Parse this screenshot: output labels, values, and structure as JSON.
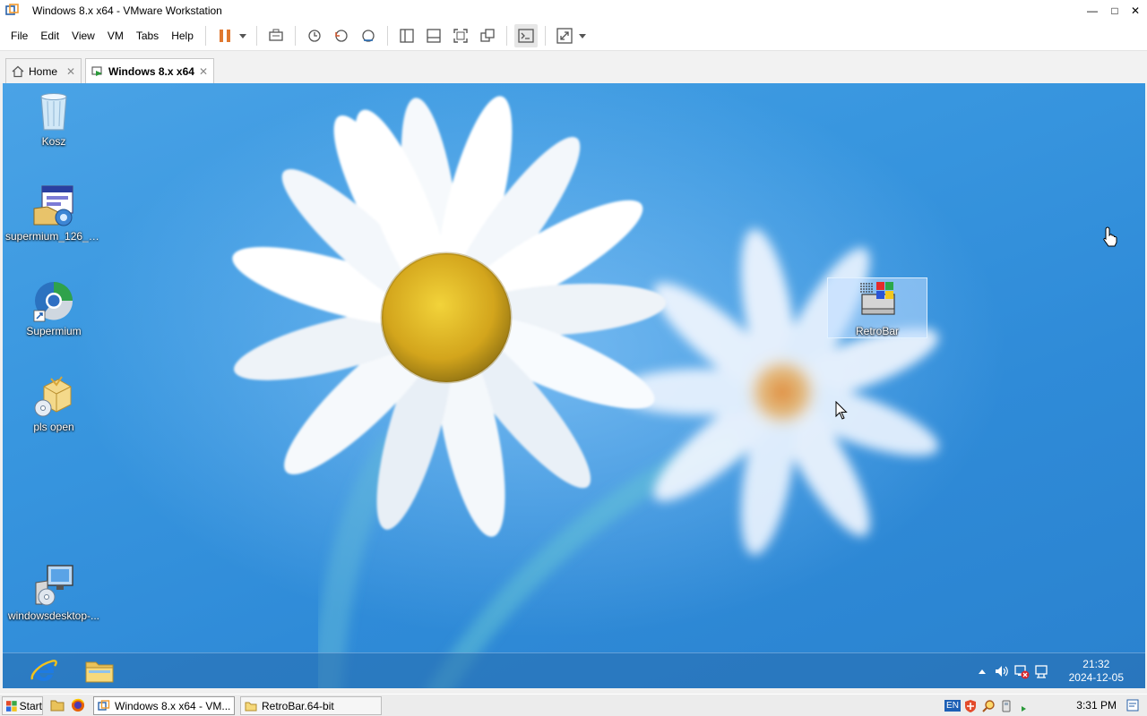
{
  "window": {
    "title": "Windows 8.x x64 - VMware Workstation",
    "controls": [
      "—",
      "□",
      "✕"
    ]
  },
  "menu": {
    "items": [
      "File",
      "Edit",
      "View",
      "VM",
      "Tabs",
      "Help"
    ]
  },
  "tabs": [
    {
      "label": "Home",
      "close": "✕"
    },
    {
      "label": "Windows 8.x x64",
      "close": "✕"
    }
  ],
  "desktop": {
    "icons": [
      {
        "label": "Kosz",
        "icon": "recycle-bin-icon"
      },
      {
        "label": "supermium_126_64...",
        "icon": "installer-icon"
      },
      {
        "label": "Supermium",
        "icon": "supermium-browser-icon"
      },
      {
        "label": "pls open",
        "icon": "package-icon"
      },
      {
        "label": "windowsdesktop-...",
        "icon": "setup-icon"
      },
      {
        "label": "RetroBar",
        "icon": "retrobar-icon",
        "selected": true
      }
    ]
  },
  "guest_taskbar": {
    "pinned": [
      "internet-explorer-icon",
      "file-explorer-icon"
    ],
    "tray": [
      "show-hidden-icon",
      "volume-icon",
      "network-x-icon",
      "action-center-icon"
    ],
    "time": "21:32",
    "date": "2024-12-05"
  },
  "host_taskbar": {
    "start_label": "Start",
    "tasks": [
      {
        "label": "Windows 8.x x64 - VM...",
        "active": true
      },
      {
        "label": "RetroBar.64-bit",
        "active": false
      }
    ],
    "language": "EN",
    "time": "3:31 PM"
  },
  "colors": {
    "wallpaper_blue": "#3896df",
    "accent": "#e07b39"
  }
}
